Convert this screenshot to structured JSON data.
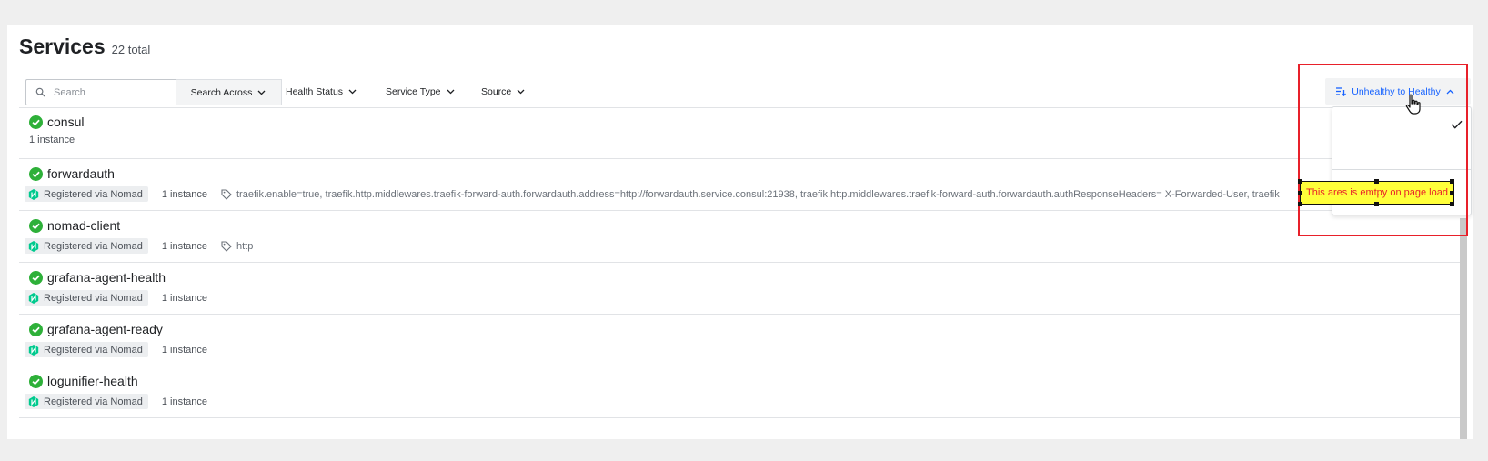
{
  "header": {
    "title": "Services",
    "total": "22 total"
  },
  "toolbar": {
    "search_placeholder": "Search",
    "search_across": "Search Across",
    "filters": [
      "Health Status",
      "Service Type",
      "Source"
    ],
    "sort_label": "Unhealthy to Healthy"
  },
  "services": [
    {
      "name": "consul",
      "instances": "1 instance",
      "source": "",
      "tags": ""
    },
    {
      "name": "forwardauth",
      "instances": "1 instance",
      "source": "Registered via Nomad",
      "tags": "traefik.enable=true, traefik.http.middlewares.traefik-forward-auth.forwardauth.address=http://forwardauth.service.consul:21938, traefik.http.middlewares.traefik-forward-auth.forwardauth.authResponseHeaders= X-Forwarded-User, traefik"
    },
    {
      "name": "nomad-client",
      "instances": "1 instance",
      "source": "Registered via Nomad",
      "tags": "http"
    },
    {
      "name": "grafana-agent-health",
      "instances": "1 instance",
      "source": "Registered via Nomad",
      "tags": ""
    },
    {
      "name": "grafana-agent-ready",
      "instances": "1 instance",
      "source": "Registered via Nomad",
      "tags": ""
    },
    {
      "name": "logunifier-health",
      "instances": "1 instance",
      "source": "Registered via Nomad",
      "tags": ""
    }
  ],
  "annotation": {
    "text": "This ares is emtpy on page load"
  },
  "colors": {
    "accent": "#1763ff",
    "healthy": "#2eb039",
    "nomad": "#00ca8e",
    "annotation": "#e8202a",
    "callout_bg": "#ffff3a"
  },
  "icons": {
    "health": "check-circle-icon",
    "source": "nomad-icon",
    "tag": "tag-icon",
    "search": "search-icon",
    "chevron": "chevron-down-icon",
    "sort": "sort-icon"
  }
}
